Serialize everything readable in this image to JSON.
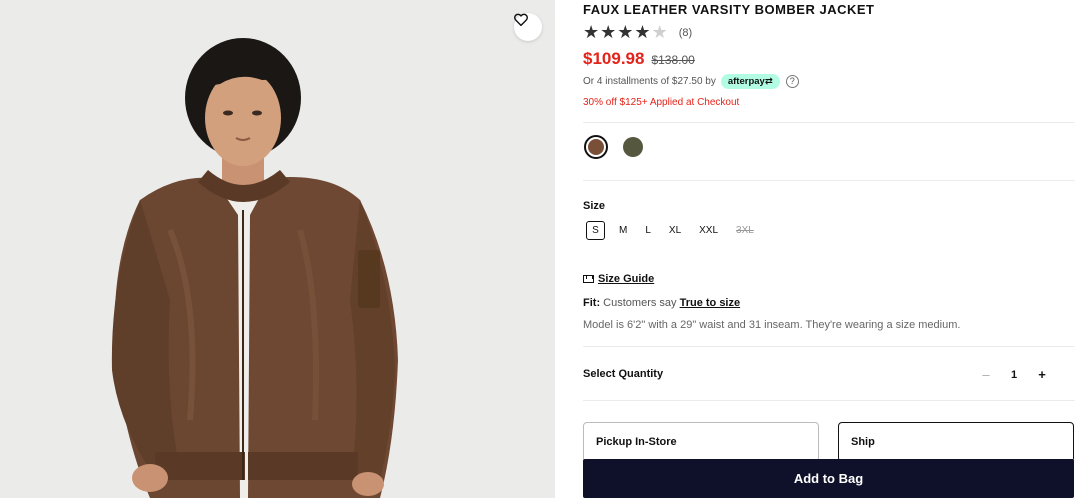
{
  "product": {
    "title": "FAUX LEATHER VARSITY BOMBER JACKET",
    "rating": 4,
    "rating_max": 5,
    "review_count": "(8)",
    "sale_price": "$109.98",
    "original_price": "$138.00",
    "installments_text": "Or 4 installments of $27.50 by",
    "afterpay_label": "afterpay",
    "promo_text": "30% off $125+ Applied at Checkout",
    "colors": {
      "accent_sale": "#e4231a",
      "button_bg": "#0f1029"
    }
  },
  "swatches": [
    {
      "name": "brown",
      "color": "#7a4f37",
      "selected": true
    },
    {
      "name": "olive",
      "color": "#55573f",
      "selected": false
    }
  ],
  "size": {
    "label": "Size",
    "options": [
      {
        "label": "S",
        "selected": true,
        "available": true
      },
      {
        "label": "M",
        "selected": false,
        "available": true
      },
      {
        "label": "L",
        "selected": false,
        "available": true
      },
      {
        "label": "XL",
        "selected": false,
        "available": true
      },
      {
        "label": "XXL",
        "selected": false,
        "available": true
      },
      {
        "label": "3XL",
        "selected": false,
        "available": false
      }
    ],
    "guide_label": "Size Guide"
  },
  "fit": {
    "label": "Fit:",
    "text": "Customers say",
    "link": "True to size"
  },
  "model_text": "Model is 6'2\" with a 29\" waist and 31 inseam. They're wearing a size medium.",
  "quantity": {
    "label": "Select Quantity",
    "value": "1",
    "minus": "–",
    "plus": "+"
  },
  "fulfillment": {
    "pickup_label": "Pickup In-Store",
    "ship_label": "Ship",
    "selected": "ship"
  },
  "cta": {
    "add_to_bag": "Add to Bag"
  },
  "icons": {
    "wishlist": "heart-icon",
    "help": "question-circle-icon",
    "size_guide": "ruler-icon"
  }
}
